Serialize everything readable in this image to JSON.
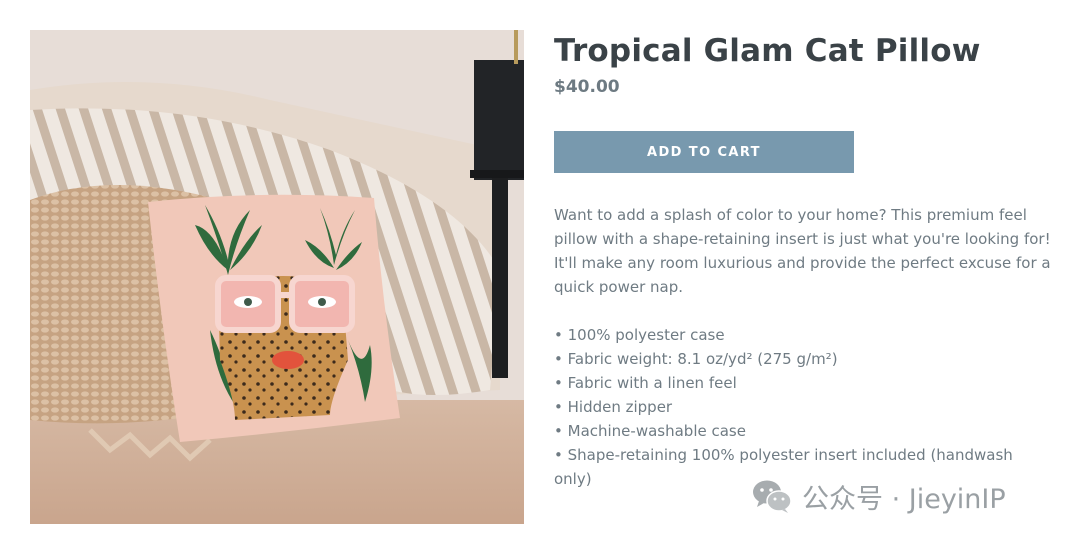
{
  "product": {
    "title": "Tropical Glam Cat Pillow",
    "price": "$40.00",
    "add_to_cart_label": "ADD TO CART",
    "description": "Want to add a splash of color to your home? This premium feel pillow with a shape-retaining insert is just what you're looking for! It'll make any room luxurious and provide the perfect excuse for a quick power nap.",
    "features": [
      "100% polyester case",
      "Fabric weight: 8.1 oz/yd² (275 g/m²)",
      "Fabric with a linen feel",
      "Hidden zipper",
      "Machine-washable case",
      "Shape-retaining 100% polyester insert included (handwash only)"
    ]
  },
  "watermark": {
    "text": "公众号 · JieyinIP",
    "icon": "wechat-icon"
  },
  "colors": {
    "button": "#7899ae",
    "title": "#3a4247",
    "body_text": "#6f7b83"
  }
}
